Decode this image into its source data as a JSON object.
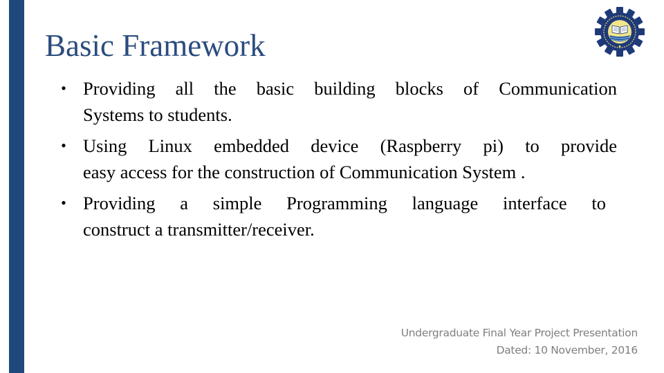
{
  "slide": {
    "title": "Basic Framework",
    "accent_color": "#1F497D",
    "logo": {
      "icon": "university-gear-emblem-icon",
      "description": "University of Engineering and Technology Taxila emblem"
    },
    "bullets": [
      {
        "lines": [
          "Providing all the basic building blocks of Communication",
          "Systems to students."
        ]
      },
      {
        "lines": [
          "Using Linux embedded device (Raspberry pi) to provide",
          "easy access for the construction of Communication System ."
        ]
      },
      {
        "lines": [
          "Providing a simple Programming language interface to",
          "construct a transmitter/receiver."
        ]
      }
    ],
    "footer": {
      "line1": "Undergraduate Final Year Project Presentation",
      "line2": "Dated: 10 November, 2016"
    }
  }
}
